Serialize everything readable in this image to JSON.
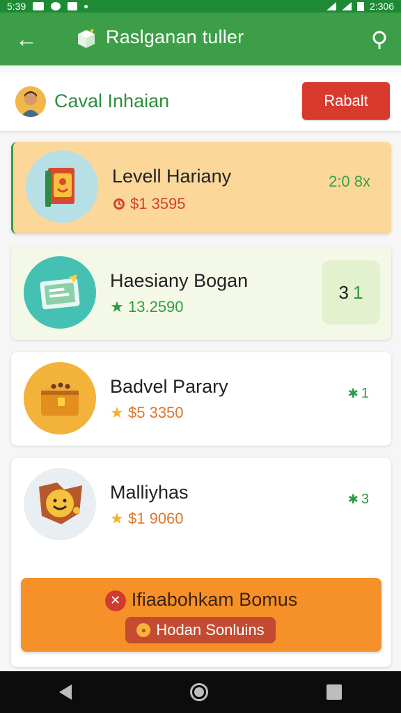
{
  "status_bar": {
    "time_left": "5:39",
    "time_right": "2:306"
  },
  "app_bar": {
    "title": "Raslganan tuller",
    "back_icon": "arrow-left-icon",
    "logo_icon": "box-logo-icon",
    "search_icon": "search-icon"
  },
  "profile": {
    "name": "Caval Inhaian",
    "action_label": "Rabalt",
    "action_color": "#d93a2e"
  },
  "levels": [
    {
      "title": "Levell Hariany",
      "meta": "$1 3595",
      "meta_icon": "clock-icon",
      "value": "2:0 8x",
      "icon": "book-icon"
    },
    {
      "title": "Haesiany Bogan",
      "meta": "13.2590",
      "meta_icon": "star-icon",
      "value_main": "3",
      "value_accent": "1",
      "icon": "certificate-icon"
    },
    {
      "title": "Badvel Parary",
      "meta": "$5 3350",
      "meta_icon": "star-icon",
      "rank": "1",
      "icon": "treasure-chest-icon"
    },
    {
      "title": "Malliyhas",
      "meta": "$1 9060",
      "meta_icon": "star-icon",
      "rank": "3",
      "icon": "smiley-badge-icon"
    }
  ],
  "bonus": {
    "title": "Ifiaabohkam Bomus",
    "button_label": "Hodan Sonluins",
    "accent_color": "#f69028"
  },
  "nav": {
    "back_icon": "nav-back-icon",
    "home_icon": "nav-home-icon",
    "recent_icon": "nav-recent-icon"
  }
}
